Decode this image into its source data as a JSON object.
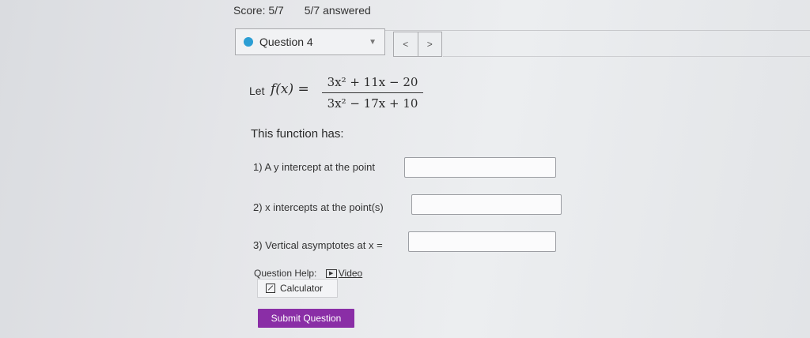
{
  "header": {
    "score": "Score: 5/7",
    "answered": "5/7 answered"
  },
  "question_selector": {
    "label": "Question 4",
    "status_color": "#2c9ed4",
    "prev_icon": "chevron-left-icon",
    "next_icon": "chevron-right-icon",
    "prev_glyph": "<",
    "next_glyph": ">"
  },
  "problem": {
    "let_label": "Let",
    "function_label": "f(x) =",
    "numerator": "3x² + 11x − 20",
    "denominator": "3x² − 17x + 10",
    "statement": "This function has:"
  },
  "questions": [
    {
      "label": "1) A y intercept at the point",
      "value": ""
    },
    {
      "label": "2) x intercepts at the point(s)",
      "value": ""
    },
    {
      "label": "3) Vertical asymptotes at x =",
      "value": ""
    }
  ],
  "help": {
    "label": "Question Help:",
    "video_label": "Video",
    "calculator_label": "Calculator"
  },
  "submit_label": "Submit Question",
  "accent_color": "#8a2ea6"
}
